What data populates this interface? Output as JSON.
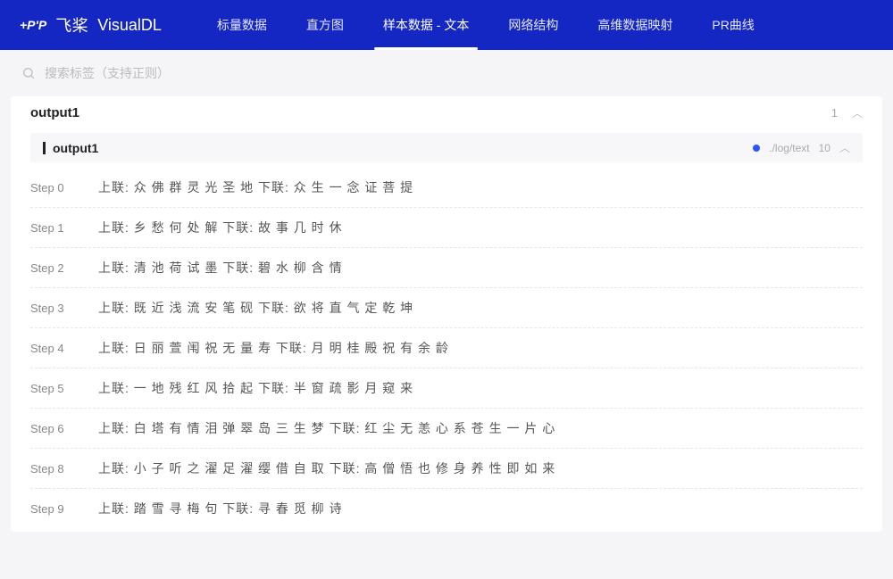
{
  "brand": {
    "logo_text": "+P'P",
    "name": "飞桨",
    "app": "VisualDL"
  },
  "nav": {
    "items": [
      {
        "label": "标量数据",
        "active": false
      },
      {
        "label": "直方图",
        "active": false
      },
      {
        "label": "样本数据 - 文本",
        "active": true
      },
      {
        "label": "网络结构",
        "active": false
      },
      {
        "label": "高维数据映射",
        "active": false
      },
      {
        "label": "PR曲线",
        "active": false
      }
    ]
  },
  "search": {
    "placeholder": "搜索标签（支持正则）"
  },
  "panel": {
    "title": "output1",
    "count": "1",
    "sub": {
      "title": "output1",
      "path": "./log/text",
      "index": "10"
    },
    "steps": [
      {
        "label": "Step 0",
        "text": "上联: 众 佛 群 灵 光 圣 地 下联: 众 生 一 念 证 菩 提"
      },
      {
        "label": "Step 1",
        "text": "上联: 乡 愁 何 处 解 下联: 故 事 几 时 休"
      },
      {
        "label": "Step 2",
        "text": "上联: 清 池 荷 试 墨 下联: 碧 水 柳 含 情"
      },
      {
        "label": "Step 3",
        "text": "上联: 既 近 浅 流 安 笔 砚 下联: 欲 将 直 气 定 乾 坤"
      },
      {
        "label": "Step 4",
        "text": "上联: 日 丽 萱 闱 祝 无 量 寿 下联: 月 明 桂 殿 祝 有 余 龄"
      },
      {
        "label": "Step 5",
        "text": "上联: 一 地 残 红 风 拾 起 下联: 半 窗 疏 影 月 窥 来"
      },
      {
        "label": "Step 6",
        "text": "上联: 白 塔 有 情 泪 弹 翠 岛 三 生 梦 下联: 红 尘 无 恙 心 系 苍 生 一 片 心"
      },
      {
        "label": "Step 8",
        "text": "上联: 小 子 听 之 濯 足 濯 缨 借 自 取 下联: 高 僧 悟 也 修 身 养 性 即 如 来"
      },
      {
        "label": "Step 9",
        "text": "上联: 踏 雪 寻 梅 句 下联: 寻 春 觅 柳 诗"
      }
    ]
  }
}
